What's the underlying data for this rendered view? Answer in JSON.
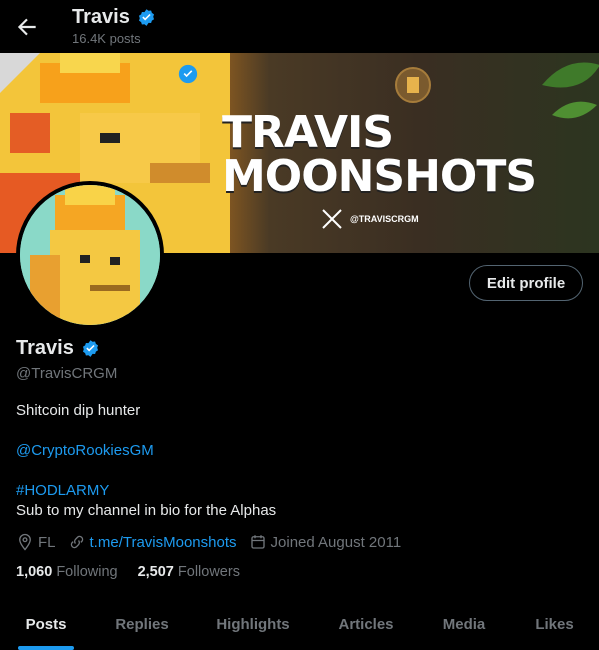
{
  "header": {
    "title": "Travis",
    "posts_count": "16.4K posts"
  },
  "banner": {
    "title_line1": "TRAVIS",
    "title_line2": "MOONSHOTS",
    "handle": "@TRAVISCRGM"
  },
  "profile": {
    "name": "Travis",
    "handle": "@TravisCRGM",
    "edit_label": "Edit profile",
    "bio_line1": "Shitcoin dip hunter",
    "bio_mention": "@CryptoRookiesGM",
    "bio_hashtag": "#HODLARMY",
    "bio_line2": "Sub to my channel in bio for the Alphas",
    "location": "FL",
    "website": "t.me/TravisMoonshots",
    "joined": "Joined August 2011",
    "following_count": "1,060",
    "following_label": "Following",
    "followers_count": "2,507",
    "followers_label": "Followers"
  },
  "tabs": [
    {
      "label": "Posts"
    },
    {
      "label": "Replies"
    },
    {
      "label": "Highlights"
    },
    {
      "label": "Articles"
    },
    {
      "label": "Media"
    },
    {
      "label": "Likes"
    }
  ],
  "colors": {
    "accent": "#1d9bf0",
    "background": "#000000",
    "text_primary": "#e7e9ea",
    "text_secondary": "#71767b"
  }
}
